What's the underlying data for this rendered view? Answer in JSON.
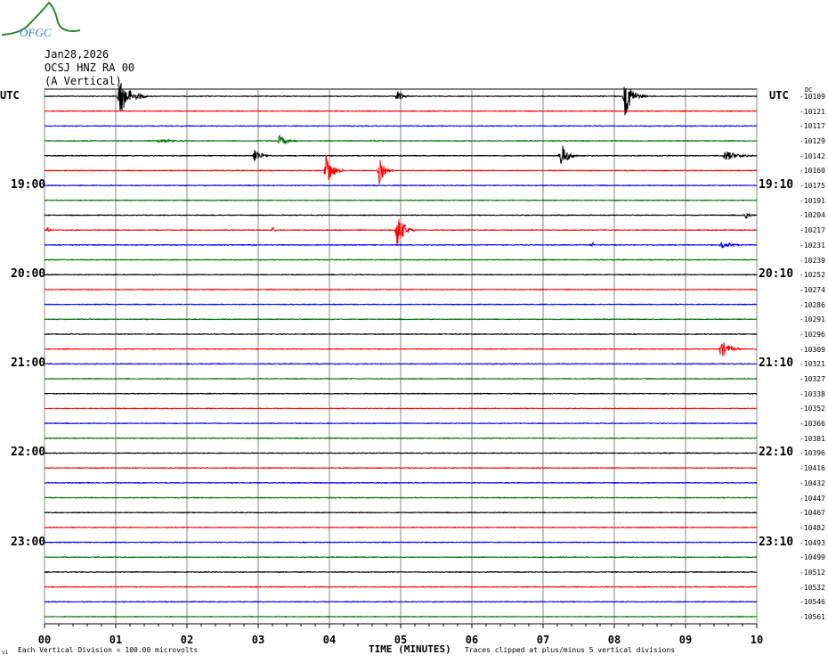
{
  "logo_text": "OFGC",
  "header": {
    "date": "Jan28,2026",
    "station": "OCSJ HNZ RA 00",
    "component": "(A Vertical)"
  },
  "left_tz_label": "UTC",
  "right_tz_label": "UTC",
  "dc_label": "DC",
  "footer": {
    "version_mark": "v1",
    "scale_note": "Each Vertical Division =  100.00 microvolts",
    "xlabel": "TIME (MINUTES)",
    "clip_note": "Traces clipped at plus/minus 5 vertical divisions"
  },
  "chart_data": {
    "type": "line",
    "subtype": "helicorder",
    "xlabel": "TIME (MINUTES)",
    "xlim": [
      0,
      10
    ],
    "x_ticks": [
      "00",
      "01",
      "02",
      "03",
      "04",
      "05",
      "06",
      "07",
      "08",
      "09",
      "10"
    ],
    "grid": true,
    "trace_colors": [
      "#000000",
      "#ff0000",
      "#0000ff",
      "#007000"
    ],
    "left_time_labels": [
      {
        "trace": 6,
        "text": "19:00"
      },
      {
        "trace": 12,
        "text": "20:00"
      },
      {
        "trace": 18,
        "text": "21:00"
      },
      {
        "trace": 24,
        "text": "22:00"
      },
      {
        "trace": 30,
        "text": "23:00"
      }
    ],
    "right_time_labels": [
      {
        "trace": 6,
        "text": "19:10"
      },
      {
        "trace": 12,
        "text": "20:10"
      },
      {
        "trace": 18,
        "text": "21:10"
      },
      {
        "trace": 24,
        "text": "22:10"
      },
      {
        "trace": 30,
        "text": "23:10"
      }
    ],
    "dc_offsets": [
      "-10109",
      "-10121",
      "-10117",
      "-10129",
      "-10142",
      "-10160",
      "-10175",
      "-10191",
      "-10204",
      "-10217",
      "-10231",
      "-10239",
      "-10252",
      "-10274",
      "-10286",
      "-10291",
      "-10296",
      "-10309",
      "-10321",
      "-10327",
      "-10338",
      "-10352",
      "-10366",
      "-10381",
      "-10396",
      "-10416",
      "-10432",
      "-10447",
      "-10467",
      "-10482",
      "-10493",
      "-10499",
      "-10512",
      "-10532",
      "-10546",
      "-10561"
    ],
    "events": [
      {
        "trace": 0,
        "minute": 1.05,
        "amplitude_div": 5,
        "duration_min": 0.4
      },
      {
        "trace": 0,
        "minute": 4.95,
        "amplitude_div": 1.5,
        "duration_min": 0.2
      },
      {
        "trace": 0,
        "minute": 8.15,
        "amplitude_div": 5,
        "duration_min": 0.3
      },
      {
        "trace": 3,
        "minute": 1.6,
        "amplitude_div": 0.5,
        "duration_min": 0.7
      },
      {
        "trace": 3,
        "minute": 3.3,
        "amplitude_div": 1.5,
        "duration_min": 0.3
      },
      {
        "trace": 4,
        "minute": 2.95,
        "amplitude_div": 2,
        "duration_min": 0.25
      },
      {
        "trace": 4,
        "minute": 7.25,
        "amplitude_div": 3.5,
        "duration_min": 0.25
      },
      {
        "trace": 4,
        "minute": 9.55,
        "amplitude_div": 1.5,
        "duration_min": 0.45
      },
      {
        "trace": 5,
        "minute": 3.95,
        "amplitude_div": 5,
        "duration_min": 0.25
      },
      {
        "trace": 5,
        "minute": 4.7,
        "amplitude_div": 3.5,
        "duration_min": 0.2
      },
      {
        "trace": 8,
        "minute": 9.85,
        "amplitude_div": 1,
        "duration_min": 0.15
      },
      {
        "trace": 9,
        "minute": 0.05,
        "amplitude_div": 0.8,
        "duration_min": 0.1
      },
      {
        "trace": 9,
        "minute": 3.2,
        "amplitude_div": 0.8,
        "duration_min": 0.1
      },
      {
        "trace": 9,
        "minute": 4.95,
        "amplitude_div": 5,
        "duration_min": 0.25
      },
      {
        "trace": 10,
        "minute": 7.7,
        "amplitude_div": 0.8,
        "duration_min": 0.05
      },
      {
        "trace": 10,
        "minute": 9.5,
        "amplitude_div": 0.8,
        "duration_min": 0.5
      },
      {
        "trace": 17,
        "minute": 9.5,
        "amplitude_div": 2.5,
        "duration_min": 0.3
      }
    ]
  }
}
